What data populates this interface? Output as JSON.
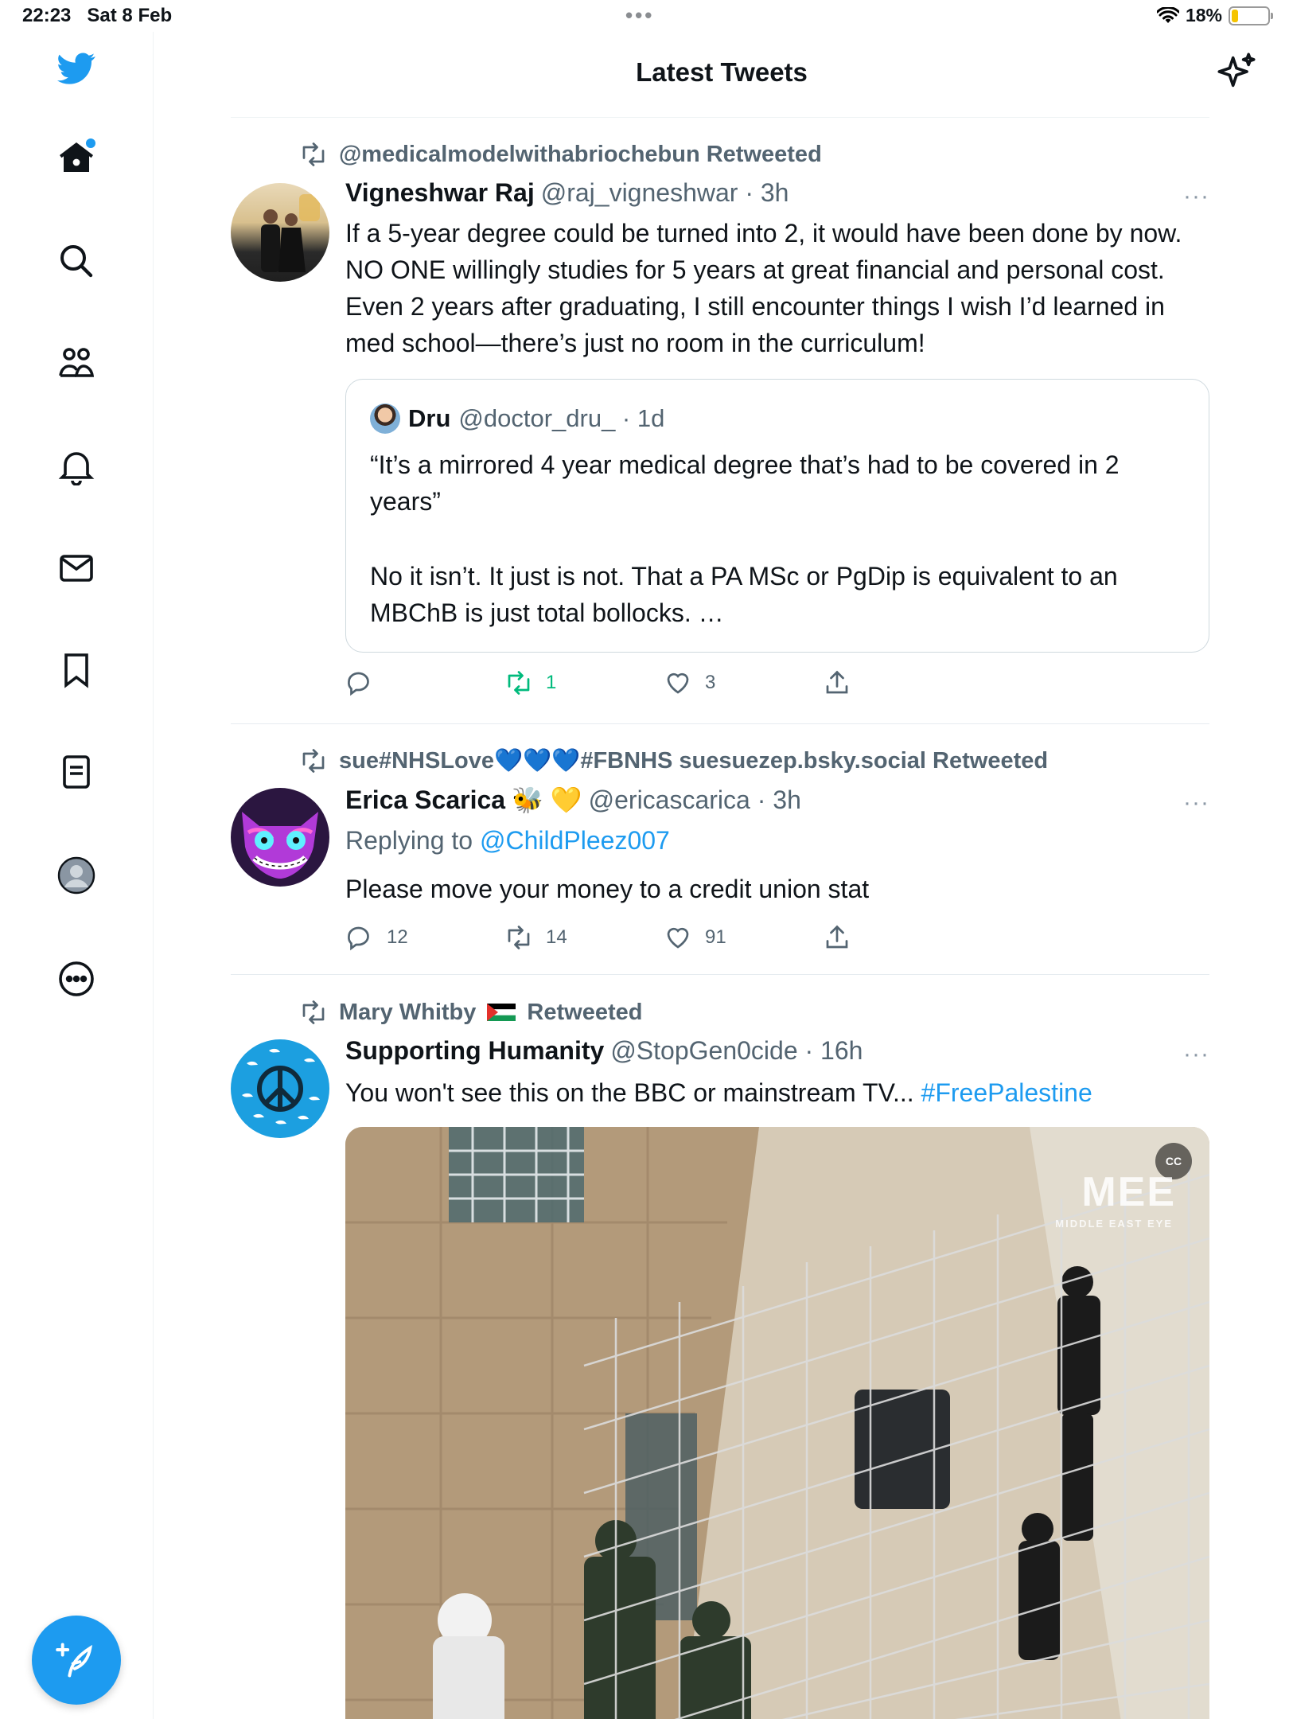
{
  "status_bar": {
    "time": "22:23",
    "date": "Sat 8 Feb",
    "battery": "18%",
    "battery_level": 0.18
  },
  "header": {
    "title": "Latest Tweets",
    "sparkle_icon": "sparkle-icon"
  },
  "sidebar": {
    "items": [
      {
        "name": "twitter-logo-icon"
      },
      {
        "name": "home-icon"
      },
      {
        "name": "search-icon"
      },
      {
        "name": "communities-icon"
      },
      {
        "name": "notifications-icon"
      },
      {
        "name": "messages-icon"
      },
      {
        "name": "bookmarks-icon"
      },
      {
        "name": "lists-icon"
      },
      {
        "name": "profile-icon"
      },
      {
        "name": "more-icon"
      }
    ],
    "compose_icon": "compose-icon"
  },
  "tweets": [
    {
      "retweeted_by": "@medicalmodelwithabriochebun Retweeted",
      "name": "Vigneshwar Raj",
      "handle": "@raj_vigneshwar · 3h",
      "text": "If a 5-year degree could be turned into 2, it would have been done by now. NO ONE willingly studies for 5 years at great financial and personal cost. Even 2 years after graduating, I still encounter things I wish I’d learned in med school—there’s just no room in the curriculum!",
      "quote": {
        "name": "Dru",
        "handle": "@doctor_dru_ · 1d",
        "text1": "“It’s a mirrored 4 year medical degree that’s had to be covered in 2 years”",
        "text2": "No it isn’t. It just is not. That a PA MSc or PgDip is equivalent to an MBChB is just total bollocks. …"
      },
      "replies": "",
      "retweets": "1",
      "likes": "3"
    },
    {
      "retweeted_by": "sue#NHSLove💙💙💙#FBNHS suesuezep.bsky.social Retweeted",
      "name": "Erica Scarica",
      "emoji": "🐝 💛",
      "handle": "@ericascarica · 3h",
      "replying_label": "Replying to ",
      "replying_to": "@ChildPleez007",
      "text": "Please move your money to a credit union stat",
      "replies": "12",
      "retweets": "14",
      "likes": "91"
    },
    {
      "retweeted_by": "Mary Whitby",
      "retweeted_suffix": "Retweeted",
      "name": "Supporting Humanity",
      "handle": "@StopGen0cide · 16h",
      "text": "You won't see this on the BBC or mainstream TV... ",
      "hashtag": "#FreePalestine",
      "media_watermark": "MEE",
      "media_watermark_sub": "MIDDLE EAST EYE",
      "cc_label": "CC"
    }
  ],
  "colors": {
    "accent": "#1d9bf0",
    "retweet_green": "#00ba7c",
    "muted": "#536471"
  }
}
